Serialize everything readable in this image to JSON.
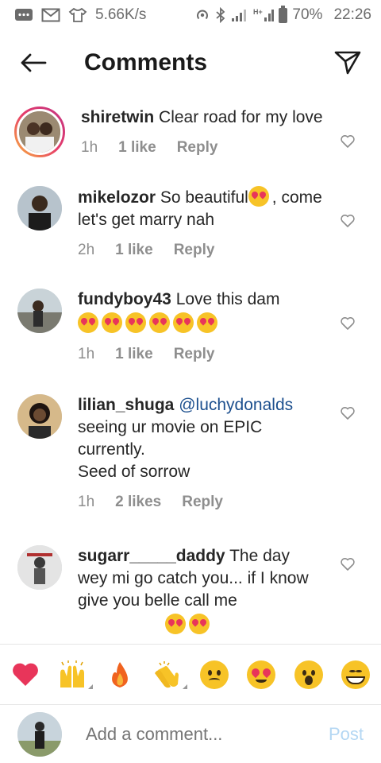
{
  "status_bar": {
    "speed": "5.66K/s",
    "network": "H+",
    "battery": "70%",
    "time": "22:26"
  },
  "header": {
    "title": "Comments",
    "back_icon": "arrow-left-icon",
    "send_icon": "paper-plane-icon"
  },
  "comments": [
    {
      "username": "shiretwin",
      "text": "Clear road for my love",
      "time": "1h",
      "likes": "1 like",
      "reply": "Reply"
    },
    {
      "username": "mikelozor",
      "text_before": "So beautiful",
      "text_after": ", come let's get marry nah",
      "time": "2h",
      "likes": "1 like",
      "reply": "Reply"
    },
    {
      "username": "fundyboy43",
      "text": "Love this dam",
      "emoji_count": 6,
      "time": "1h",
      "likes": "1 like",
      "reply": "Reply"
    },
    {
      "username": "lilian_shuga",
      "mention": "@luchydonalds",
      "text": "seeing ur movie on EPIC currently.",
      "text2": "Seed of sorrow",
      "time": "1h",
      "likes": "2 likes",
      "reply": "Reply"
    },
    {
      "username": "sugarr_____daddy",
      "text": "The day wey mi go catch you... if I know give you belle call me"
    }
  ],
  "reactions": [
    "heart",
    "raised-hands",
    "fire",
    "clapping-hands",
    "sad-face",
    "heart-eyes-face",
    "surprised-face",
    "grinning-face"
  ],
  "input": {
    "placeholder": "Add a comment...",
    "post_label": "Post"
  },
  "colors": {
    "text": "#262626",
    "meta": "#8e8e8e",
    "mention": "#1c4f8e",
    "post_disabled": "#b4d7f3",
    "heart": "#e8355a"
  }
}
